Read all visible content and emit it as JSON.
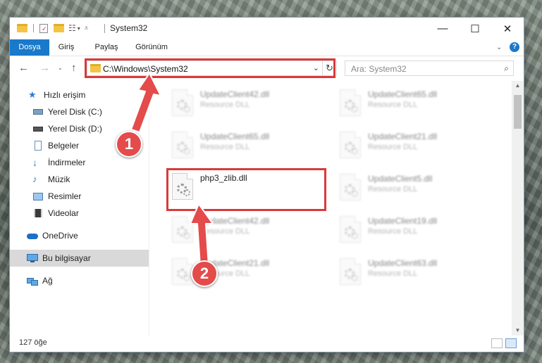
{
  "window": {
    "title": "System32"
  },
  "ribbon": {
    "tabs": [
      "Dosya",
      "Giriş",
      "Paylaş",
      "Görünüm"
    ]
  },
  "address": {
    "path": "C:\\Windows\\System32"
  },
  "search": {
    "placeholder": "Ara: System32"
  },
  "sidebar": {
    "items": [
      {
        "label": "Hızlı erişim",
        "icon": "star-icon"
      },
      {
        "label": "Yerel Disk (C:)",
        "icon": "drive-icon"
      },
      {
        "label": "Yerel Disk (D:)",
        "icon": "drive-icon"
      },
      {
        "label": "Belgeler",
        "icon": "document-icon"
      },
      {
        "label": "İndirmeler",
        "icon": "download-icon"
      },
      {
        "label": "Müzik",
        "icon": "music-icon"
      },
      {
        "label": "Resimler",
        "icon": "pictures-icon"
      },
      {
        "label": "Videolar",
        "icon": "video-icon"
      },
      {
        "label": "OneDrive",
        "icon": "cloud-icon"
      },
      {
        "label": "Bu bilgisayar",
        "icon": "computer-icon"
      },
      {
        "label": "Ağ",
        "icon": "network-icon"
      }
    ]
  },
  "files": [
    {
      "name": "UpdateClient42.dll",
      "type": "Resource DLL"
    },
    {
      "name": "UpdateClient65.dll",
      "type": "Resource DLL"
    },
    {
      "name": "UpdateClient65.dll",
      "type": "Resource DLL"
    },
    {
      "name": "UpdateClient21.dll",
      "type": "Resource DLL"
    },
    {
      "name": "php3_zlib.dll",
      "type": ""
    },
    {
      "name": "UpdateClient5.dll",
      "type": "Resource DLL"
    },
    {
      "name": "UpdateClient42.dll",
      "type": "Resource DLL"
    },
    {
      "name": "UpdateClient19.dll",
      "type": "Resource DLL"
    },
    {
      "name": "UpdateClient21.dll",
      "type": "Resource DLL"
    },
    {
      "name": "UpdateClient63.dll",
      "type": "Resource DLL"
    }
  ],
  "status": {
    "item_count": "127 öğe"
  },
  "annotations": {
    "step1": "1",
    "step2": "2",
    "color": "#e44b4b"
  }
}
